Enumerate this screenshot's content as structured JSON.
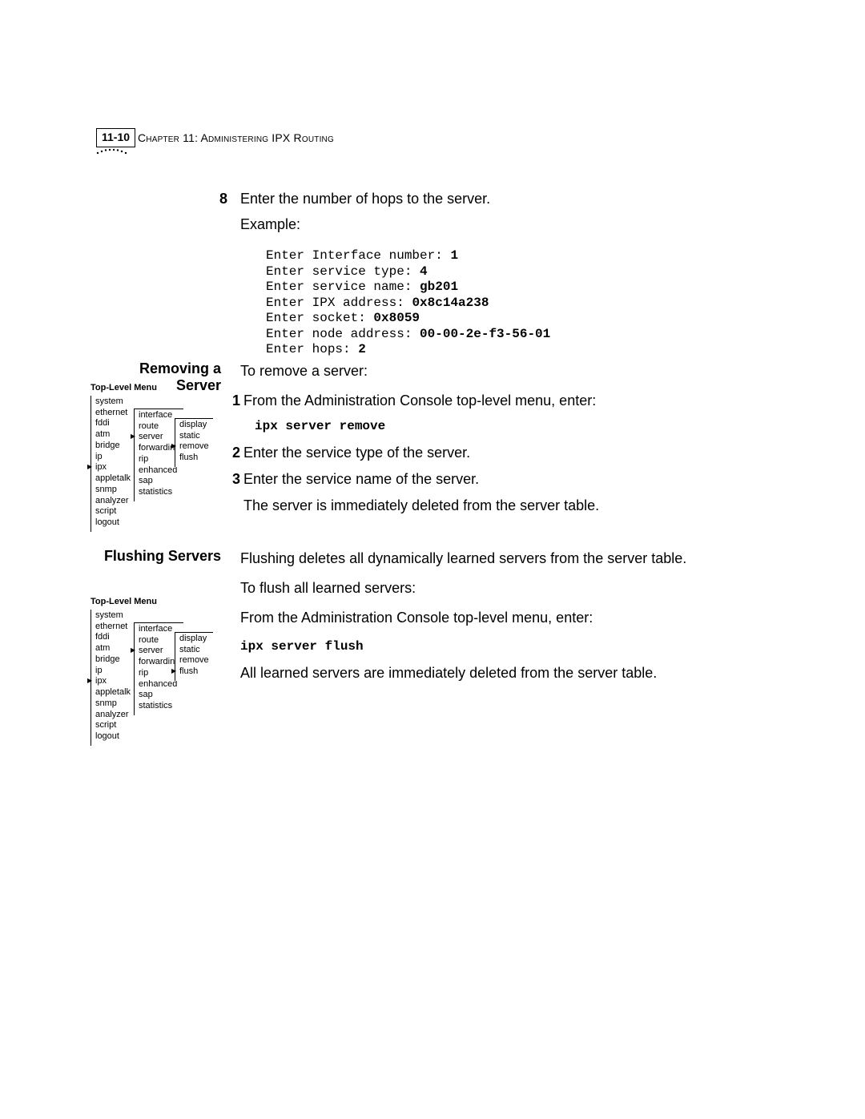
{
  "header": {
    "page_number": "11-10",
    "chapter_label": "Chapter 11: Administering IPX Routing"
  },
  "step8": {
    "num": "8",
    "text": "Enter the number of hops to the server.",
    "example_label": "Example:"
  },
  "code": {
    "l1a": "Enter Interface number: ",
    "l1b": "1",
    "l2a": "Enter service type: ",
    "l2b": "4",
    "l3a": "Enter service name: ",
    "l3b": "gb201",
    "l4a": "Enter IPX address: ",
    "l4b": "0x8c14a238",
    "l5a": "Enter socket: ",
    "l5b": "0x8059",
    "l6a": "Enter node address: ",
    "l6b": "00-00-2e-f3-56-01",
    "l7a": "Enter hops: ",
    "l7b": "2"
  },
  "removing": {
    "heading": "Removing a Server",
    "intro": "To remove a server:",
    "step1": "From the Administration Console top-level menu, enter:",
    "cmd": "ipx server remove",
    "step2": "Enter the service type of the server.",
    "step3": "Enter the service name of the server.",
    "result": "The server is immediately deleted from the server table."
  },
  "flushing": {
    "heading": "Flushing Servers",
    "intro": "Flushing deletes all dynamically learned servers from the server table.",
    "line2": "To flush all learned servers:",
    "line3": "From the Administration Console top-level menu, enter:",
    "cmd": "ipx server flush",
    "result": "All learned servers are immediately deleted from the server table."
  },
  "menu": {
    "title": "Top-Level Menu",
    "col1": [
      "system",
      "ethernet",
      "fddi",
      "atm",
      "bridge",
      "ip",
      "ipx",
      "appletalk",
      "snmp",
      "analyzer",
      "script",
      "logout"
    ],
    "col2": [
      "interface",
      "route",
      "server",
      "forwarding",
      "rip",
      "enhanced",
      "sap",
      "statistics"
    ],
    "col3": [
      "display",
      "static",
      "remove",
      "flush"
    ],
    "sel1": "ipx",
    "sel2": "server",
    "sel3_remove": "remove",
    "sel3_flush": "flush"
  }
}
